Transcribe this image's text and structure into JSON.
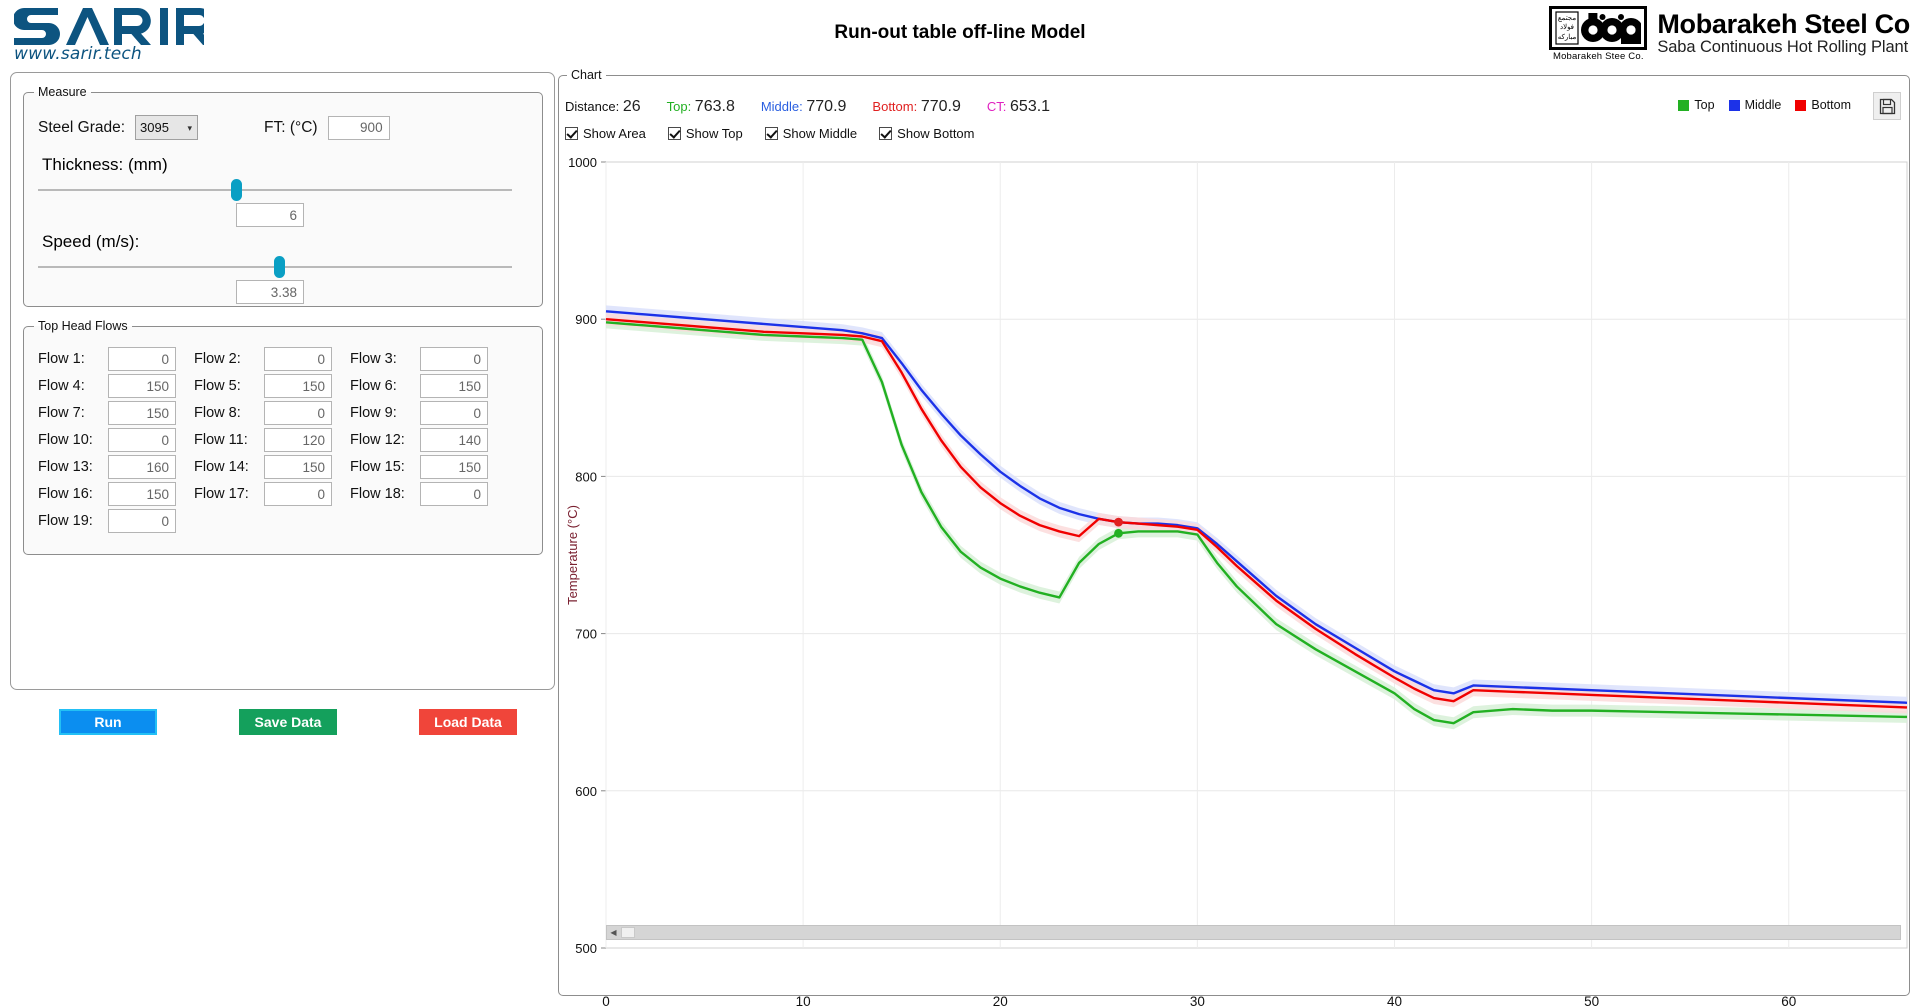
{
  "header": {
    "logo_text": "SARIR",
    "logo_url": "www.sarir.tech",
    "title": "Run-out table off-line Model",
    "brand_name": "Mobarakeh Steel Co",
    "brand_sub": "Saba Continuous Hot Rolling Plant",
    "brand_mark_caption": "Mobarakeh Stee  Co."
  },
  "measure": {
    "legend": "Measure",
    "steel_grade_label": "Steel Grade:",
    "steel_grade_value": "3095",
    "steel_grade_options": [
      "3095"
    ],
    "ft_label": "FT: (°C)",
    "ft_value": "900",
    "thickness_label": "Thickness: (mm)",
    "thickness_value": "6",
    "speed_label": "Speed (m/s):",
    "speed_value": "3.38"
  },
  "flows": {
    "legend": "Top Head Flows",
    "items": [
      {
        "label": "Flow 1:",
        "value": "0"
      },
      {
        "label": "Flow 2:",
        "value": "0"
      },
      {
        "label": "Flow 3:",
        "value": "0"
      },
      {
        "label": "Flow 4:",
        "value": "150"
      },
      {
        "label": "Flow 5:",
        "value": "150"
      },
      {
        "label": "Flow 6:",
        "value": "150"
      },
      {
        "label": "Flow 7:",
        "value": "150"
      },
      {
        "label": "Flow 8:",
        "value": "0"
      },
      {
        "label": "Flow 9:",
        "value": "0"
      },
      {
        "label": "Flow 10:",
        "value": "0"
      },
      {
        "label": "Flow 11:",
        "value": "120"
      },
      {
        "label": "Flow 12:",
        "value": "140"
      },
      {
        "label": "Flow 13:",
        "value": "160"
      },
      {
        "label": "Flow 14:",
        "value": "150"
      },
      {
        "label": "Flow 15:",
        "value": "150"
      },
      {
        "label": "Flow 16:",
        "value": "150"
      },
      {
        "label": "Flow 17:",
        "value": "0"
      },
      {
        "label": "Flow 18:",
        "value": "0"
      },
      {
        "label": "Flow 19:",
        "value": "0"
      }
    ]
  },
  "buttons": {
    "run": "Run",
    "save": "Save Data",
    "load": "Load Data"
  },
  "chart_panel": {
    "legend": "Chart",
    "readouts": [
      {
        "key": "Distance:",
        "value": "26",
        "color": "#111111"
      },
      {
        "key": "Top:",
        "value": "763.8",
        "color": "#22b022"
      },
      {
        "key": "Middle:",
        "value": "770.9",
        "color": "#2a5fe0"
      },
      {
        "key": "Bottom:",
        "value": "770.9",
        "color": "#e02020"
      },
      {
        "key": "CT:",
        "value": "653.1",
        "color": "#e020c0"
      }
    ],
    "checkboxes": [
      {
        "label": "Show Area",
        "checked": true
      },
      {
        "label": "Show Top",
        "checked": true
      },
      {
        "label": "Show Middle",
        "checked": true
      },
      {
        "label": "Show Bottom",
        "checked": true
      }
    ],
    "legend_items": [
      {
        "label": "Top",
        "color": "#22b022"
      },
      {
        "label": "Middle",
        "color": "#1c32e8"
      },
      {
        "label": "Bottom",
        "color": "#f00000"
      }
    ],
    "save_icon": "floppy-disk-icon"
  },
  "chart_data": {
    "type": "line",
    "title": "",
    "xlabel": "",
    "ylabel": "Temperature (°C)",
    "xlim": [
      0,
      66
    ],
    "ylim": [
      500,
      1000
    ],
    "xticks": [
      0,
      10,
      20,
      30,
      40,
      50,
      60
    ],
    "yticks": [
      500,
      600,
      700,
      800,
      900,
      1000
    ],
    "grid": true,
    "legend_position": "top-right",
    "band_label": "confidence band (Show Area)",
    "x": [
      0,
      2,
      4,
      6,
      8,
      10,
      12,
      13,
      14,
      15,
      16,
      17,
      18,
      19,
      20,
      21,
      22,
      23,
      24,
      25,
      26,
      27,
      28,
      29,
      30,
      31,
      32,
      33,
      34,
      36,
      38,
      40,
      41,
      42,
      43,
      44,
      46,
      48,
      50,
      54,
      58,
      62,
      66
    ],
    "series": [
      {
        "name": "Top",
        "color": "#22b022",
        "band": "#d7f0d7",
        "values": [
          898,
          896,
          894,
          892,
          890,
          889,
          888,
          887,
          860,
          820,
          790,
          768,
          752,
          742,
          735,
          730,
          726,
          723,
          745,
          757,
          763.8,
          765,
          765,
          765,
          763,
          745,
          730,
          718,
          706,
          690,
          676,
          662,
          652,
          645,
          643,
          650,
          652,
          651,
          651,
          650,
          649,
          648,
          647
        ]
      },
      {
        "name": "Middle",
        "color": "#1c32e8",
        "band": "#dbe0fb",
        "values": [
          905,
          903,
          901,
          899,
          897,
          895,
          893,
          891,
          888,
          872,
          855,
          840,
          826,
          814,
          803,
          794,
          786,
          780,
          776,
          773,
          770.9,
          770,
          770,
          769,
          767,
          757,
          746,
          735,
          724,
          706,
          691,
          676,
          670,
          664,
          662,
          667,
          666,
          665,
          664,
          662,
          660,
          658,
          656
        ]
      },
      {
        "name": "Bottom",
        "color": "#f00000",
        "band": "#fbdada",
        "values": [
          900,
          898,
          896,
          894,
          892,
          891,
          890,
          889,
          886,
          866,
          843,
          823,
          806,
          793,
          783,
          775,
          769,
          765,
          762,
          773,
          770.9,
          770,
          769,
          768,
          766,
          755,
          743,
          732,
          721,
          703,
          687,
          672,
          665,
          659,
          657,
          664,
          663,
          662,
          661,
          659,
          657,
          655,
          653
        ]
      }
    ],
    "markers": [
      {
        "series": "Bottom",
        "x": 26,
        "y": 770.9,
        "color": "#e02020"
      },
      {
        "series": "Top",
        "x": 26,
        "y": 763.8,
        "color": "#22b022"
      }
    ]
  },
  "scrollbar": {
    "orientation": "horizontal",
    "position": "start"
  }
}
